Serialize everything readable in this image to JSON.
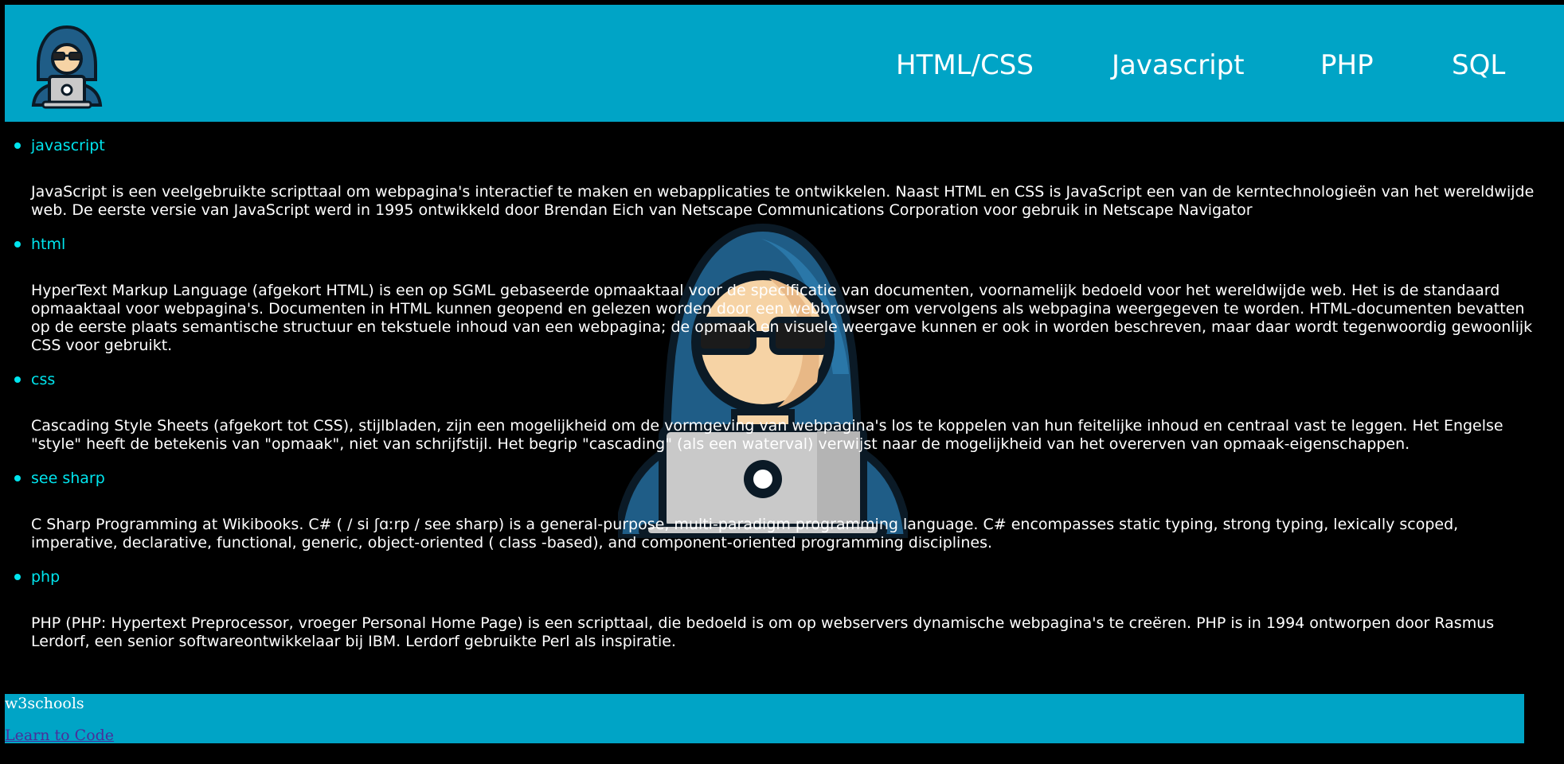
{
  "nav": {
    "items": [
      {
        "label": "HTML/CSS"
      },
      {
        "label": "Javascript"
      },
      {
        "label": "PHP"
      },
      {
        "label": "SQL"
      }
    ]
  },
  "topics": [
    {
      "title": "javascript",
      "text": "JavaScript is een veelgebruikte scripttaal om webpagina's interactief te maken en webapplicaties te ontwikkelen. Naast HTML en CSS is JavaScript een van de kerntechnologieën van het wereldwijde web. De eerste versie van JavaScript werd in 1995 ontwikkeld door Brendan Eich van Netscape Communications Corporation voor gebruik in Netscape Navigator"
    },
    {
      "title": "html",
      "text": "HyperText Markup Language (afgekort HTML) is een op SGML gebaseerde opmaaktaal voor de specificatie van documenten, voornamelijk bedoeld voor het wereldwijde web. Het is de standaard opmaaktaal voor webpagina's. Documenten in HTML kunnen geopend en gelezen worden door een webbrowser om vervolgens als webpagina weergegeven te worden. HTML-documenten bevatten op de eerste plaats semantische structuur en tekstuele inhoud van een webpagina; de opmaak en visuele weergave kunnen er ook in worden beschreven, maar daar wordt tegenwoordig gewoonlijk CSS voor gebruikt."
    },
    {
      "title": "css",
      "text": "Cascading Style Sheets (afgekort tot CSS), stijlbladen, zijn een mogelijkheid om de vormgeving van webpagina's los te koppelen van hun feitelijke inhoud en centraal vast te leggen. Het Engelse \"style\" heeft de betekenis van \"opmaak\", niet van schrijfstijl. Het begrip \"cascading\" (als een waterval) verwijst naar de mogelijkheid van het overerven van opmaak-eigenschappen."
    },
    {
      "title": "see sharp",
      "text": "C Sharp Programming at Wikibooks. C# ( / si ʃɑːrp / see sharp) is a general-purpose, multi-paradigm programming language. C# encompasses static typing, strong typing, lexically scoped, imperative, declarative, functional, generic, object-oriented ( class -based), and component-oriented programming disciplines."
    },
    {
      "title": "php",
      "text": "PHP (PHP: Hypertext Preprocessor, vroeger Personal Home Page) is een scripttaal, die bedoeld is om op webservers dynamische webpagina's te creëren. PHP is in 1994 ontworpen door Rasmus Lerdorf, een senior softwareontwikkelaar bij IBM. Lerdorf gebruikte Perl als inspiratie."
    }
  ],
  "footer": {
    "title": "w3schools",
    "link": "Learn to Code"
  },
  "icons": {
    "logo": "hacker-laptop-icon",
    "hero": "hacker-laptop-illustration"
  },
  "colors": {
    "header_bg": "#00a4c6",
    "topic_title": "#00e5ee",
    "footer_link": "#4a2e9a"
  }
}
